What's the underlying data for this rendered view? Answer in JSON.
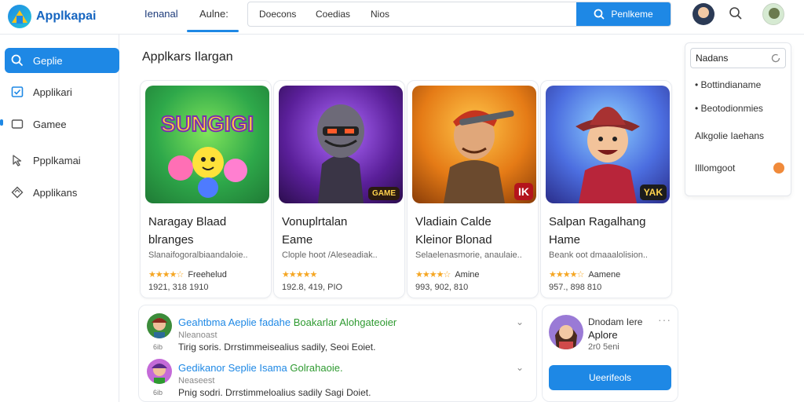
{
  "app": {
    "title": "Applkapai"
  },
  "header": {
    "tabs": [
      {
        "label": "Ienanal"
      },
      {
        "label": "Aulne:"
      }
    ],
    "chips": [
      "Doecons",
      "Coedias",
      "Nios"
    ],
    "search_button": "Penlkeme"
  },
  "sidebar": {
    "items": [
      {
        "label": "Geplie",
        "icon": "search-icon"
      },
      {
        "label": "Applikari",
        "icon": "app-window-icon"
      },
      {
        "label": "Gamee",
        "icon": "gamepad-icon"
      },
      {
        "label": "Ppplkamai",
        "icon": "pointer-icon"
      },
      {
        "label": "Applikans",
        "icon": "diamond-icon"
      }
    ]
  },
  "main": {
    "section_title": "Applkars Ilargan",
    "cards": [
      {
        "name_line1": "Naragay Blaad",
        "name_line2": "blranges",
        "desc": "Slanaifogoralbiaandaloie..",
        "rating": "Freehelud",
        "stats": "1921, 318 1910",
        "stars": 4,
        "art_text": "SUNGIGI",
        "badge": ""
      },
      {
        "name_line1": "Vonuplrtalan",
        "name_line2": "Eame",
        "desc": "Clople hoot /Aleseadiak..",
        "rating": "",
        "stats": "192.8, 419, PIO",
        "stars": 5,
        "art_text": "",
        "badge": "GAME"
      },
      {
        "name_line1": "Vladiain Calde",
        "name_line2": "Kleinor Blonad",
        "desc": "Selaelenasmorie, anaulaie..",
        "rating": "Amine",
        "stats": "993, 902, 810",
        "stars": 4,
        "art_text": "",
        "badge": "IK"
      },
      {
        "name_line1": "Salpan Ragalhang",
        "name_line2": "Hame",
        "desc": "Beank oot dmaaalolision..",
        "rating": "Aamene",
        "stats": "957., 898 810",
        "stars": 4,
        "art_text": "",
        "badge": "YAK"
      }
    ]
  },
  "right_panel": {
    "search_value": "Nadans",
    "items": [
      "• Bottindianame",
      "• Beotodionmies",
      "Alkgolie Iaehans",
      "Illlomgoot"
    ]
  },
  "feed": [
    {
      "headline_a": "Geahtbma Aeplie fadahe",
      "headline_b": "Boakarlar Alohgateoier",
      "sub": "Nleanoast",
      "body": "Tirig soris. Drrstimmeisealius sadily, Seoi Eoiet.",
      "small": "6ib"
    },
    {
      "headline_a": "Gedikanor Seplie Isama",
      "headline_b": "Golrahaoie.",
      "sub": "Neaseest",
      "body": "Pnig sodri. Drrstimmeloalius sadily Sagi Doiet.",
      "small": "6ib"
    }
  ],
  "profile": {
    "name": "Dnodam Iere",
    "title": "Aplore",
    "meta": "2r0 5eni",
    "button": "Ueerifeols"
  },
  "colors": {
    "accent": "#1e88e5",
    "star": "#f5a623"
  }
}
